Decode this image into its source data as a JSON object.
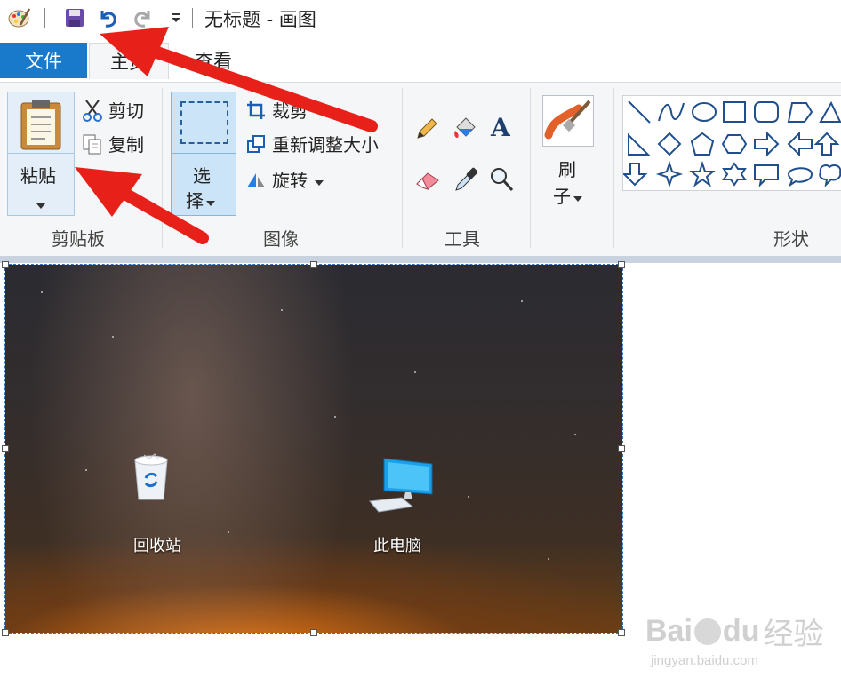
{
  "titlebar": {
    "title": "无标题 - 画图",
    "icons": [
      "paint-app-icon",
      "save-icon",
      "undo-icon",
      "redo-icon",
      "customize-quick-access-icon"
    ]
  },
  "tabs": {
    "file": "文件",
    "home": "主页",
    "view": "查看"
  },
  "clipboard": {
    "paste": "粘贴",
    "cut": "剪切",
    "copy": "复制",
    "label": "剪贴板"
  },
  "image": {
    "select_line1": "选",
    "select_line2": "择",
    "crop": "裁剪",
    "resize": "重新调整大小",
    "rotate": "旋转",
    "label": "图像"
  },
  "tools": {
    "label": "工具",
    "items": [
      "pencil-icon",
      "fill-icon",
      "text-icon",
      "eraser-icon",
      "color-picker-icon",
      "magnifier-icon"
    ]
  },
  "brushes": {
    "line1": "刷",
    "line2": "子"
  },
  "shapes": {
    "label": "形状"
  },
  "canvas": {
    "recycle_bin": "回收站",
    "this_pc": "此电脑"
  },
  "watermark": {
    "brand": "Bai",
    "brand2": "du",
    "product": "经验",
    "url": "jingyan.baidu.com"
  },
  "colors": {
    "accent": "#1979ca",
    "arrow": "#e8201a",
    "selection": "#2e6fb7"
  }
}
